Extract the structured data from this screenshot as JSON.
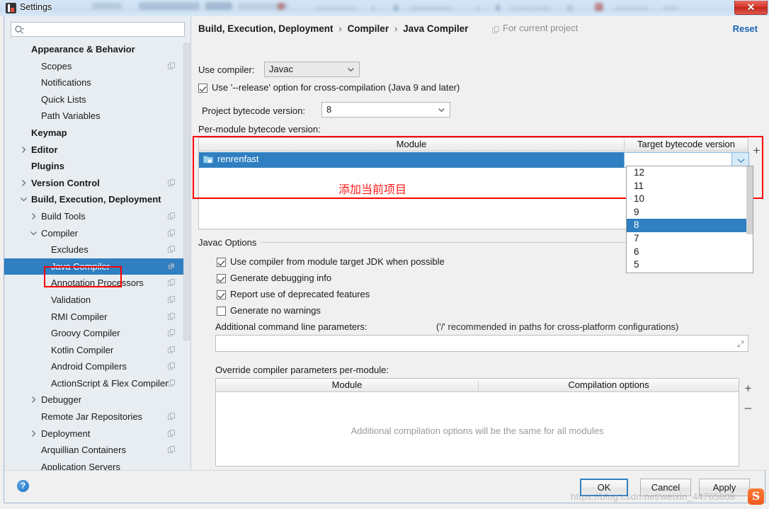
{
  "window": {
    "title": "Settings",
    "close_label": "✕"
  },
  "sidebar": {
    "search": {
      "value": "",
      "placeholder": ""
    },
    "items": [
      {
        "label": "Appearance & Behavior",
        "indent": 38,
        "bold": true,
        "chevron": "none",
        "copy": false,
        "selected": false
      },
      {
        "label": "Scopes",
        "indent": 52,
        "bold": false,
        "chevron": "none",
        "copy": true,
        "selected": false
      },
      {
        "label": "Notifications",
        "indent": 52,
        "bold": false,
        "chevron": "none",
        "copy": false,
        "selected": false
      },
      {
        "label": "Quick Lists",
        "indent": 52,
        "bold": false,
        "chevron": "none",
        "copy": false,
        "selected": false
      },
      {
        "label": "Path Variables",
        "indent": 52,
        "bold": false,
        "chevron": "none",
        "copy": false,
        "selected": false
      },
      {
        "label": "Keymap",
        "indent": 38,
        "bold": true,
        "chevron": "none",
        "copy": false,
        "selected": false
      },
      {
        "label": "Editor",
        "indent": 38,
        "bold": true,
        "chevron": "right",
        "copy": false,
        "selected": false
      },
      {
        "label": "Plugins",
        "indent": 38,
        "bold": true,
        "chevron": "none",
        "copy": false,
        "selected": false
      },
      {
        "label": "Version Control",
        "indent": 38,
        "bold": true,
        "chevron": "right",
        "copy": true,
        "selected": false
      },
      {
        "label": "Build, Execution, Deployment",
        "indent": 38,
        "bold": true,
        "chevron": "down",
        "copy": false,
        "selected": false
      },
      {
        "label": "Build Tools",
        "indent": 52,
        "bold": false,
        "chevron": "right",
        "copy": true,
        "selected": false
      },
      {
        "label": "Compiler",
        "indent": 52,
        "bold": false,
        "chevron": "down",
        "copy": true,
        "selected": false
      },
      {
        "label": "Excludes",
        "indent": 66,
        "bold": false,
        "chevron": "none",
        "copy": true,
        "selected": false
      },
      {
        "label": "Java Compiler",
        "indent": 66,
        "bold": false,
        "chevron": "none",
        "copy": true,
        "selected": true
      },
      {
        "label": "Annotation Processors",
        "indent": 66,
        "bold": false,
        "chevron": "none",
        "copy": true,
        "selected": false
      },
      {
        "label": "Validation",
        "indent": 66,
        "bold": false,
        "chevron": "none",
        "copy": true,
        "selected": false
      },
      {
        "label": "RMI Compiler",
        "indent": 66,
        "bold": false,
        "chevron": "none",
        "copy": true,
        "selected": false
      },
      {
        "label": "Groovy Compiler",
        "indent": 66,
        "bold": false,
        "chevron": "none",
        "copy": true,
        "selected": false
      },
      {
        "label": "Kotlin Compiler",
        "indent": 66,
        "bold": false,
        "chevron": "none",
        "copy": true,
        "selected": false
      },
      {
        "label": "Android Compilers",
        "indent": 66,
        "bold": false,
        "chevron": "none",
        "copy": true,
        "selected": false
      },
      {
        "label": "ActionScript & Flex Compiler",
        "indent": 66,
        "bold": false,
        "chevron": "none",
        "copy": true,
        "selected": false
      },
      {
        "label": "Debugger",
        "indent": 52,
        "bold": false,
        "chevron": "right",
        "copy": false,
        "selected": false
      },
      {
        "label": "Remote Jar Repositories",
        "indent": 52,
        "bold": false,
        "chevron": "none",
        "copy": true,
        "selected": false
      },
      {
        "label": "Deployment",
        "indent": 52,
        "bold": false,
        "chevron": "right",
        "copy": true,
        "selected": false
      },
      {
        "label": "Arquillian Containers",
        "indent": 52,
        "bold": false,
        "chevron": "none",
        "copy": true,
        "selected": false
      },
      {
        "label": "Application Servers",
        "indent": 52,
        "bold": false,
        "chevron": "none",
        "copy": false,
        "selected": false
      }
    ]
  },
  "main": {
    "breadcrumb": {
      "part1": "Build, Execution, Deployment",
      "part2": "Compiler",
      "part3": "Java Compiler",
      "separator": "›"
    },
    "for_current_project": "For current project",
    "reset_label": "Reset",
    "use_compiler_label": "Use compiler:",
    "use_compiler_value": "Javac",
    "release_option_label": "Use '--release' option for cross-compilation (Java 9 and later)",
    "release_option_checked": true,
    "project_bytecode_label": "Project bytecode version:",
    "project_bytecode_value": "8",
    "per_module_label": "Per-module bytecode version:",
    "module_table": {
      "columns": [
        "Module",
        "Target bytecode version"
      ],
      "rows": [
        {
          "module": "renrenfast",
          "target": "",
          "selected": true
        }
      ],
      "add_button": "+"
    },
    "dropdown": {
      "options": [
        "12",
        "11",
        "10",
        "9",
        "8",
        "7",
        "6",
        "5"
      ],
      "selected": "8"
    },
    "javac_options": {
      "group_title": "Javac Options",
      "checkboxes": [
        {
          "label": "Use compiler from module target JDK when possible",
          "checked": true
        },
        {
          "label": "Generate debugging info",
          "checked": true
        },
        {
          "label": "Report use of deprecated features",
          "checked": true
        },
        {
          "label": "Generate no warnings",
          "checked": false
        }
      ],
      "additional_params_label": "Additional command line parameters:",
      "additional_params_hint": "('/' recommended in paths for cross-platform configurations)",
      "additional_params_value": ""
    },
    "override_section": {
      "label": "Override compiler parameters per-module:",
      "columns": [
        "Module",
        "Compilation options"
      ],
      "empty_text": "Additional compilation options will be the same for all modules",
      "add_button": "+",
      "remove_button": "–"
    }
  },
  "annotation": {
    "note_text": "添加当前项目",
    "color": "#ff0000"
  },
  "footer": {
    "help_label": "?",
    "ok_label": "OK",
    "cancel_label": "Cancel",
    "apply_label": "Apply"
  },
  "watermark": {
    "url": "https://blog.csdn.net/weixin_44765608",
    "logo": "S"
  }
}
